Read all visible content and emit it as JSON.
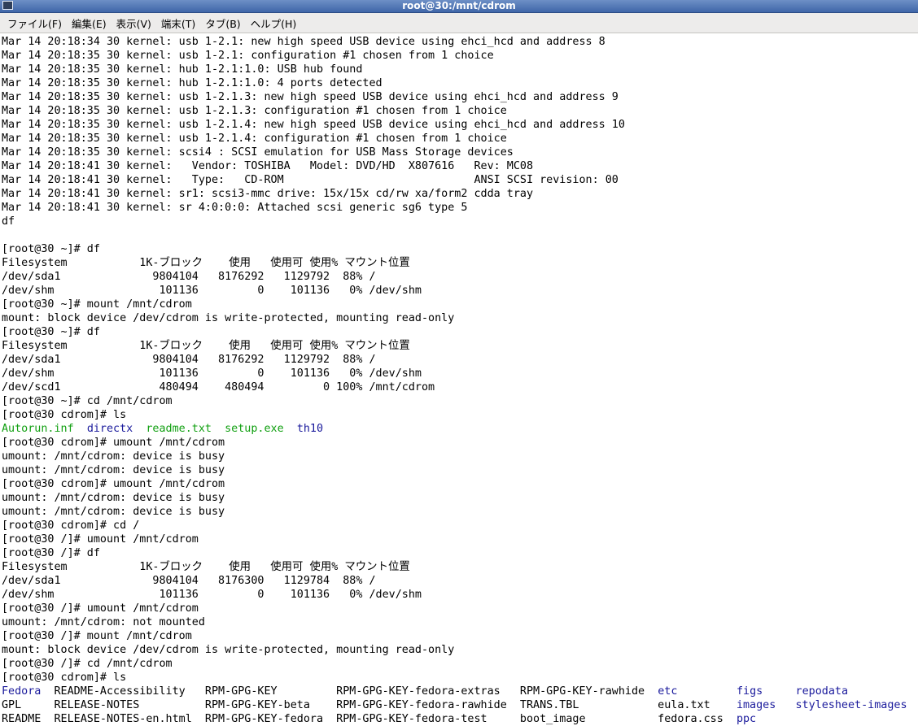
{
  "window": {
    "title": "root@30:/mnt/cdrom"
  },
  "menubar": {
    "items": [
      {
        "label": "ファイル(F)"
      },
      {
        "label": "編集(E)"
      },
      {
        "label": "表示(V)"
      },
      {
        "label": "端末(T)"
      },
      {
        "label": "タブ(B)"
      },
      {
        "label": "ヘルプ(H)"
      }
    ]
  },
  "colors": {
    "directory": "#1a1a9c",
    "executable": "#12a012"
  },
  "terminal": {
    "lines": [
      [
        {
          "t": "Mar 14 20:18:34 30 kernel: usb 1-2.1: new high speed USB device using ehci_hcd and address 8"
        }
      ],
      [
        {
          "t": "Mar 14 20:18:35 30 kernel: usb 1-2.1: configuration #1 chosen from 1 choice"
        }
      ],
      [
        {
          "t": "Mar 14 20:18:35 30 kernel: hub 1-2.1:1.0: USB hub found"
        }
      ],
      [
        {
          "t": "Mar 14 20:18:35 30 kernel: hub 1-2.1:1.0: 4 ports detected"
        }
      ],
      [
        {
          "t": "Mar 14 20:18:35 30 kernel: usb 1-2.1.3: new high speed USB device using ehci_hcd and address 9"
        }
      ],
      [
        {
          "t": "Mar 14 20:18:35 30 kernel: usb 1-2.1.3: configuration #1 chosen from 1 choice"
        }
      ],
      [
        {
          "t": "Mar 14 20:18:35 30 kernel: usb 1-2.1.4: new high speed USB device using ehci_hcd and address 10"
        }
      ],
      [
        {
          "t": "Mar 14 20:18:35 30 kernel: usb 1-2.1.4: configuration #1 chosen from 1 choice"
        }
      ],
      [
        {
          "t": "Mar 14 20:18:35 30 kernel: scsi4 : SCSI emulation for USB Mass Storage devices"
        }
      ],
      [
        {
          "t": "Mar 14 20:18:41 30 kernel:   Vendor: TOSHIBA   Model: DVD/HD  X807616   Rev: MC08"
        }
      ],
      [
        {
          "t": "Mar 14 20:18:41 30 kernel:   Type:   CD-ROM                             ANSI SCSI revision: 00"
        }
      ],
      [
        {
          "t": "Mar 14 20:18:41 30 kernel: sr1: scsi3-mmc drive: 15x/15x cd/rw xa/form2 cdda tray"
        }
      ],
      [
        {
          "t": "Mar 14 20:18:41 30 kernel: sr 4:0:0:0: Attached scsi generic sg6 type 5"
        }
      ],
      [
        {
          "t": "df"
        }
      ],
      [
        {
          "t": ""
        }
      ],
      [
        {
          "t": "[root@30 ~]# df"
        }
      ],
      [
        {
          "t": "Filesystem           1K-ブロック    使用   使用可 使用% マウント位置"
        }
      ],
      [
        {
          "t": "/dev/sda1              9804104   8176292   1129792  88% /"
        }
      ],
      [
        {
          "t": "/dev/shm                101136         0    101136   0% /dev/shm"
        }
      ],
      [
        {
          "t": "[root@30 ~]# mount /mnt/cdrom"
        }
      ],
      [
        {
          "t": "mount: block device /dev/cdrom is write-protected, mounting read-only"
        }
      ],
      [
        {
          "t": "[root@30 ~]# df"
        }
      ],
      [
        {
          "t": "Filesystem           1K-ブロック    使用   使用可 使用% マウント位置"
        }
      ],
      [
        {
          "t": "/dev/sda1              9804104   8176292   1129792  88% /"
        }
      ],
      [
        {
          "t": "/dev/shm                101136         0    101136   0% /dev/shm"
        }
      ],
      [
        {
          "t": "/dev/scd1               480494    480494         0 100% /mnt/cdrom"
        }
      ],
      [
        {
          "t": "[root@30 ~]# cd /mnt/cdrom"
        }
      ],
      [
        {
          "t": "[root@30 cdrom]# ls"
        }
      ],
      [
        {
          "t": "Autorun.inf",
          "c": "green"
        },
        {
          "t": "  "
        },
        {
          "t": "directx",
          "c": "blue"
        },
        {
          "t": "  "
        },
        {
          "t": "readme.txt",
          "c": "green"
        },
        {
          "t": "  "
        },
        {
          "t": "setup.exe",
          "c": "green"
        },
        {
          "t": "  "
        },
        {
          "t": "th10",
          "c": "blue"
        }
      ],
      [
        {
          "t": "[root@30 cdrom]# umount /mnt/cdrom"
        }
      ],
      [
        {
          "t": "umount: /mnt/cdrom: device is busy"
        }
      ],
      [
        {
          "t": "umount: /mnt/cdrom: device is busy"
        }
      ],
      [
        {
          "t": "[root@30 cdrom]# umount /mnt/cdrom"
        }
      ],
      [
        {
          "t": "umount: /mnt/cdrom: device is busy"
        }
      ],
      [
        {
          "t": "umount: /mnt/cdrom: device is busy"
        }
      ],
      [
        {
          "t": "[root@30 cdrom]# cd /"
        }
      ],
      [
        {
          "t": "[root@30 /]# umount /mnt/cdrom"
        }
      ],
      [
        {
          "t": "[root@30 /]# df"
        }
      ],
      [
        {
          "t": "Filesystem           1K-ブロック    使用   使用可 使用% マウント位置"
        }
      ],
      [
        {
          "t": "/dev/sda1              9804104   8176300   1129784  88% /"
        }
      ],
      [
        {
          "t": "/dev/shm                101136         0    101136   0% /dev/shm"
        }
      ],
      [
        {
          "t": "[root@30 /]# umount /mnt/cdrom"
        }
      ],
      [
        {
          "t": "umount: /mnt/cdrom: not mounted"
        }
      ],
      [
        {
          "t": "[root@30 /]# mount /mnt/cdrom"
        }
      ],
      [
        {
          "t": "mount: block device /dev/cdrom is write-protected, mounting read-only"
        }
      ],
      [
        {
          "t": "[root@30 /]# cd /mnt/cdrom"
        }
      ],
      [
        {
          "t": "[root@30 cdrom]# ls"
        }
      ],
      [
        {
          "t": "Fedora",
          "c": "blue"
        },
        {
          "t": "  README-Accessibility   RPM-GPG-KEY         RPM-GPG-KEY-fedora-extras   RPM-GPG-KEY-rawhide  "
        },
        {
          "t": "etc",
          "c": "blue"
        },
        {
          "t": "         "
        },
        {
          "t": "figs",
          "c": "blue"
        },
        {
          "t": "     "
        },
        {
          "t": "repodata",
          "c": "blue"
        }
      ],
      [
        {
          "t": "GPL     RELEASE-NOTES          RPM-GPG-KEY-beta    RPM-GPG-KEY-fedora-rawhide  TRANS.TBL            eula.txt    "
        },
        {
          "t": "images",
          "c": "blue"
        },
        {
          "t": "   "
        },
        {
          "t": "stylesheet-images",
          "c": "blue"
        }
      ],
      [
        {
          "t": "README  RELEASE-NOTES-en.html  RPM-GPG-KEY-fedora  RPM-GPG-KEY-fedora-test     boot_image           fedora.css  "
        },
        {
          "t": "ppc",
          "c": "blue"
        }
      ]
    ]
  }
}
